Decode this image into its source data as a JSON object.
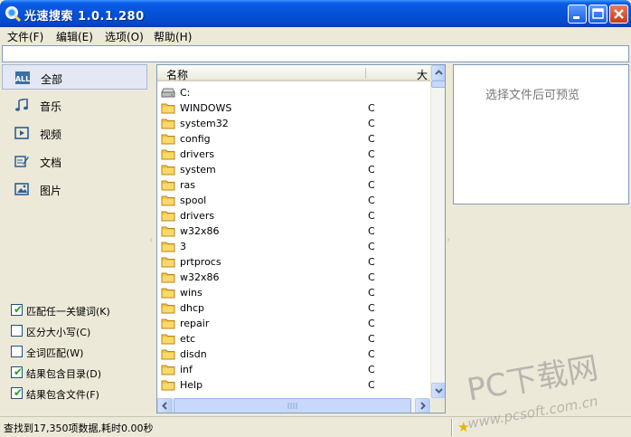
{
  "window": {
    "title": "光速搜索 1.0.1.280"
  },
  "menu": [
    {
      "label": "文件(F)"
    },
    {
      "label": "编辑(E)"
    },
    {
      "label": "选项(O)"
    },
    {
      "label": "帮助(H)"
    }
  ],
  "search": {
    "value": "",
    "placeholder": ""
  },
  "categories": [
    {
      "label": "全部",
      "icon": "all-icon",
      "selected": true
    },
    {
      "label": "音乐",
      "icon": "music-note-icon",
      "selected": false
    },
    {
      "label": "视频",
      "icon": "video-icon",
      "selected": false
    },
    {
      "label": "文档",
      "icon": "document-icon",
      "selected": false
    },
    {
      "label": "图片",
      "icon": "picture-icon",
      "selected": false
    }
  ],
  "options": [
    {
      "label": "匹配任一关键词(K)",
      "checked": true
    },
    {
      "label": "区分大小写(C)",
      "checked": false
    },
    {
      "label": "全词匹配(W)",
      "checked": false
    },
    {
      "label": "结果包含目录(D)",
      "checked": true
    },
    {
      "label": "结果包含文件(F)",
      "checked": true
    }
  ],
  "list": {
    "columns": {
      "name": "名称",
      "size": "大"
    },
    "rows": [
      {
        "name": "C:",
        "size": "",
        "icon": "drive-icon"
      },
      {
        "name": "WINDOWS",
        "size": "C",
        "icon": "folder-icon"
      },
      {
        "name": "system32",
        "size": "C",
        "icon": "folder-icon"
      },
      {
        "name": "config",
        "size": "C",
        "icon": "folder-icon"
      },
      {
        "name": "drivers",
        "size": "C",
        "icon": "folder-icon"
      },
      {
        "name": "system",
        "size": "C",
        "icon": "folder-icon"
      },
      {
        "name": "ras",
        "size": "C",
        "icon": "folder-icon"
      },
      {
        "name": "spool",
        "size": "C",
        "icon": "folder-icon"
      },
      {
        "name": "drivers",
        "size": "C",
        "icon": "folder-icon"
      },
      {
        "name": "w32x86",
        "size": "C",
        "icon": "folder-icon"
      },
      {
        "name": "3",
        "size": "C",
        "icon": "folder-icon"
      },
      {
        "name": "prtprocs",
        "size": "C",
        "icon": "folder-icon"
      },
      {
        "name": "w32x86",
        "size": "C",
        "icon": "folder-icon"
      },
      {
        "name": "wins",
        "size": "C",
        "icon": "folder-icon"
      },
      {
        "name": "dhcp",
        "size": "C",
        "icon": "folder-icon"
      },
      {
        "name": "repair",
        "size": "C",
        "icon": "folder-icon"
      },
      {
        "name": "etc",
        "size": "C",
        "icon": "folder-icon"
      },
      {
        "name": "disdn",
        "size": "C",
        "icon": "folder-icon"
      },
      {
        "name": "inf",
        "size": "C",
        "icon": "folder-icon"
      },
      {
        "name": "Help",
        "size": "C",
        "icon": "folder-icon"
      }
    ]
  },
  "preview": {
    "text": "选择文件后可预览"
  },
  "status": {
    "text": "查找到17,350项数据,耗时0.00秒"
  },
  "watermark": {
    "line1": "PC下载网",
    "line2": "www.pcsoft.com.cn"
  },
  "colors": {
    "title_bar": "#0552d9",
    "folder": "#f5c542",
    "check": "#21a121"
  }
}
